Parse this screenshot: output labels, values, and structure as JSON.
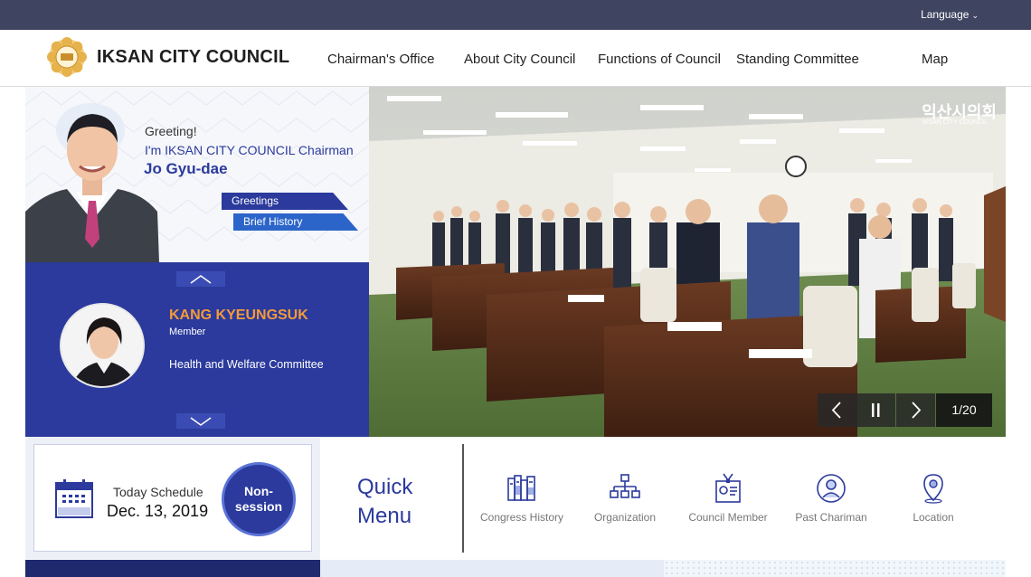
{
  "topbar": {
    "language_label": "Language"
  },
  "header": {
    "logo_text": "IKSAN CITY COUNCIL",
    "nav": [
      "Chairman's Office",
      "About City Council",
      "Functions of Council",
      "Standing Committee",
      "Map"
    ]
  },
  "chairman": {
    "greeting": "Greeting!",
    "intro": "I'm IKSAN CITY COUNCIL Chairman",
    "name": "Jo Gyu-dae",
    "links": [
      "Greetings",
      "Brief History"
    ]
  },
  "member": {
    "name": "KANG KYEUNGSUK",
    "role": "Member",
    "committee": "Health and Welfare Committee"
  },
  "slideshow": {
    "watermark_kr": "익산시의회",
    "watermark_en": "IKSAN CITY COUNCIL",
    "counter": "1/20"
  },
  "schedule": {
    "label": "Today Schedule",
    "date": "Dec. 13, 2019",
    "status_line1": "Non-",
    "status_line2": "session"
  },
  "quick_menu": {
    "title_line1": "Quick",
    "title_line2": "Menu",
    "items": [
      {
        "label": "Congress History",
        "icon": "books-icon"
      },
      {
        "label": "Organization",
        "icon": "org-chart-icon"
      },
      {
        "label": "Council Member",
        "icon": "id-badge-icon"
      },
      {
        "label": "Past Chariman",
        "icon": "person-icon"
      },
      {
        "label": "Location",
        "icon": "map-pin-icon"
      }
    ]
  },
  "colors": {
    "primary": "#2b3a9c",
    "topbar": "#3f4561",
    "accent": "#f39a3a"
  }
}
